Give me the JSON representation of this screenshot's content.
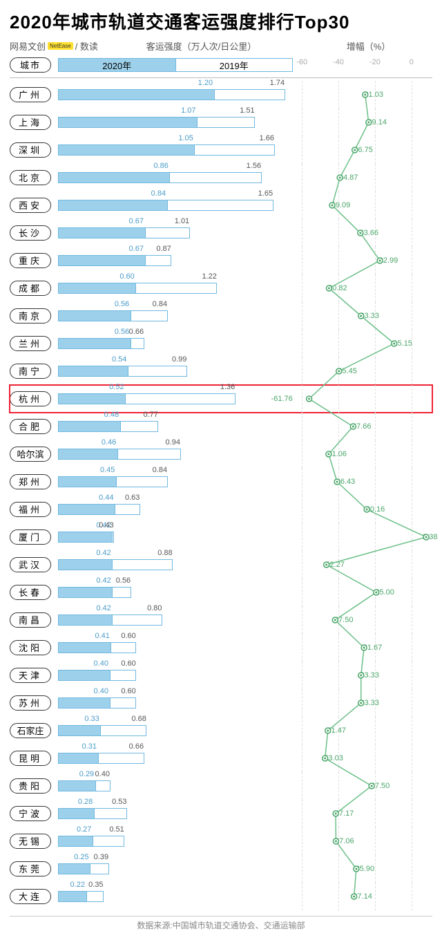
{
  "title": "2020年城市轨道交通客运强度排行Top30",
  "brand_pre": "网易文创",
  "brand_logo": "NetEase",
  "brand_post": "/ 数读",
  "axis_label": "客运强度（万人次/日公里）",
  "growth_label": "增幅（%）",
  "city_header": "城市",
  "legend_2020": "2020年",
  "legend_2019": "2019年",
  "growth_ticks": [
    -60,
    -40,
    -20,
    0
  ],
  "footer": "数据来源:中国城市轨道交通协会、交通运输部",
  "bar_max": 1.8,
  "growth_range": [
    -65,
    5
  ],
  "highlight_city": "杭州",
  "chart_data": {
    "type": "bar",
    "title": "2020年城市轨道交通客运强度排行Top30",
    "xlabel": "客运强度（万人次/日公里）",
    "ylabel": "城市",
    "series": [
      {
        "name": "2020年",
        "values": [
          1.2,
          1.07,
          1.05,
          0.86,
          0.84,
          0.67,
          0.67,
          0.6,
          0.56,
          0.56,
          0.54,
          0.52,
          0.48,
          0.46,
          0.45,
          0.44,
          0.42,
          0.42,
          0.42,
          0.42,
          0.41,
          0.4,
          0.4,
          0.33,
          0.31,
          0.29,
          0.28,
          0.27,
          0.25,
          0.22
        ]
      },
      {
        "name": "2019年",
        "values": [
          1.74,
          1.51,
          1.66,
          1.56,
          1.65,
          1.01,
          0.87,
          1.22,
          0.84,
          0.66,
          0.99,
          1.36,
          0.77,
          0.94,
          0.84,
          0.63,
          0.43,
          0.88,
          0.56,
          0.8,
          0.6,
          0.6,
          0.6,
          0.68,
          0.66,
          0.4,
          0.53,
          0.51,
          0.39,
          0.35
        ]
      },
      {
        "name": "增幅(%)",
        "values": [
          -31.03,
          -29.14,
          -36.75,
          -44.87,
          -49.09,
          -33.66,
          -22.99,
          -50.82,
          -33.33,
          -15.15,
          -45.45,
          -61.76,
          -37.66,
          -51.06,
          -46.43,
          -30.16,
          2.38,
          -52.27,
          -25.0,
          -47.5,
          -31.67,
          -33.33,
          -33.33,
          -51.47,
          -53.03,
          -27.5,
          -47.17,
          -47.06,
          -35.9,
          -37.14
        ]
      }
    ],
    "categories": [
      "广州",
      "上海",
      "深圳",
      "北京",
      "西安",
      "长沙",
      "重庆",
      "成都",
      "南京",
      "兰州",
      "南宁",
      "杭州",
      "合肥",
      "哈尔滨",
      "郑州",
      "福州",
      "厦门",
      "武汉",
      "长春",
      "南昌",
      "沈阳",
      "天津",
      "苏州",
      "石家庄",
      "昆明",
      "贵阳",
      "宁波",
      "无锡",
      "东莞",
      "大连"
    ]
  }
}
